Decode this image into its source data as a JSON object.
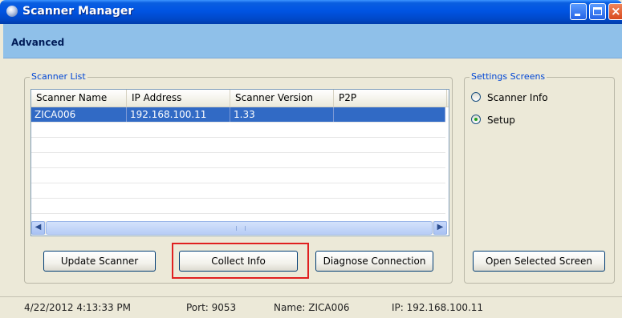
{
  "window": {
    "title": "Scanner Manager"
  },
  "advanced": {
    "label": "Advanced"
  },
  "scanner_list": {
    "group_title": "Scanner List",
    "columns": [
      "Scanner Name",
      "IP Address",
      "Scanner Version",
      "P2P"
    ],
    "rows": [
      {
        "name": "ZICA006",
        "ip": "192.168.100.11",
        "version": "1.33",
        "p2p": "",
        "selected": true
      }
    ]
  },
  "settings": {
    "group_title": "Settings Screens",
    "options": [
      {
        "label": "Scanner Info",
        "checked": false
      },
      {
        "label": "Setup",
        "checked": true
      }
    ]
  },
  "buttons": {
    "update": "Update Scanner",
    "collect": "Collect Info",
    "diagnose": "Diagnose Connection",
    "open": "Open Selected Screen"
  },
  "status": {
    "datetime": "4/22/2012 4:13:33 PM",
    "port": "Port: 9053",
    "name": "Name: ZICA006",
    "ip": "IP: 192.168.100.11"
  },
  "colors": {
    "highlight_box": "#e02020",
    "selection": "#316ac5"
  }
}
